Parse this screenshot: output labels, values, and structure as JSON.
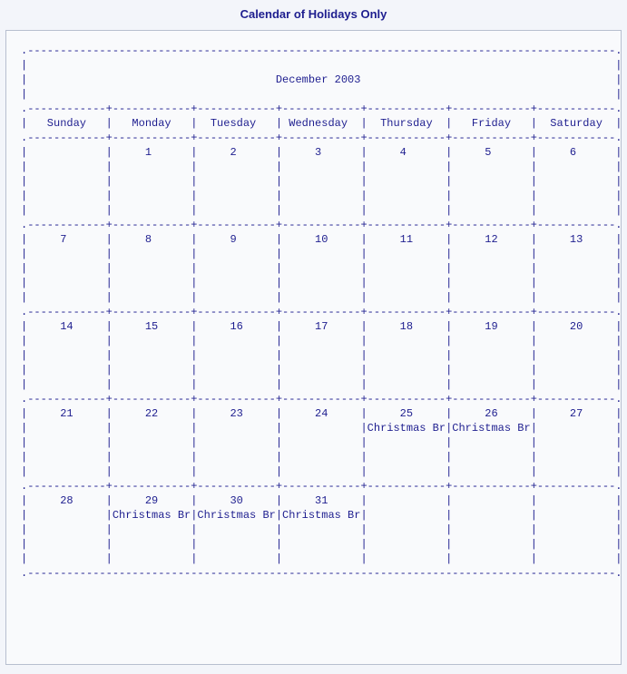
{
  "title": "Calendar of Holidays Only",
  "calendar": {
    "month_label": "December 2003",
    "day_names": [
      "Sunday",
      "Monday",
      "Tuesday",
      "Wednesday",
      "Thursday",
      "Friday",
      "Saturday"
    ],
    "weeks": [
      {
        "days": [
          {
            "num": "",
            "event": ""
          },
          {
            "num": "1",
            "event": ""
          },
          {
            "num": "2",
            "event": ""
          },
          {
            "num": "3",
            "event": ""
          },
          {
            "num": "4",
            "event": ""
          },
          {
            "num": "5",
            "event": ""
          },
          {
            "num": "6",
            "event": ""
          }
        ]
      },
      {
        "days": [
          {
            "num": "7",
            "event": ""
          },
          {
            "num": "8",
            "event": ""
          },
          {
            "num": "9",
            "event": ""
          },
          {
            "num": "10",
            "event": ""
          },
          {
            "num": "11",
            "event": ""
          },
          {
            "num": "12",
            "event": ""
          },
          {
            "num": "13",
            "event": ""
          }
        ]
      },
      {
        "days": [
          {
            "num": "14",
            "event": ""
          },
          {
            "num": "15",
            "event": ""
          },
          {
            "num": "16",
            "event": ""
          },
          {
            "num": "17",
            "event": ""
          },
          {
            "num": "18",
            "event": ""
          },
          {
            "num": "19",
            "event": ""
          },
          {
            "num": "20",
            "event": ""
          }
        ]
      },
      {
        "days": [
          {
            "num": "21",
            "event": ""
          },
          {
            "num": "22",
            "event": ""
          },
          {
            "num": "23",
            "event": ""
          },
          {
            "num": "24",
            "event": ""
          },
          {
            "num": "25",
            "event": "Christmas Br"
          },
          {
            "num": "26",
            "event": "Christmas Br"
          },
          {
            "num": "27",
            "event": ""
          }
        ]
      },
      {
        "days": [
          {
            "num": "28",
            "event": ""
          },
          {
            "num": "29",
            "event": "Christmas Br"
          },
          {
            "num": "30",
            "event": "Christmas Br"
          },
          {
            "num": "31",
            "event": "Christmas Br"
          },
          {
            "num": "",
            "event": ""
          },
          {
            "num": "",
            "event": ""
          }
        ]
      }
    ]
  }
}
